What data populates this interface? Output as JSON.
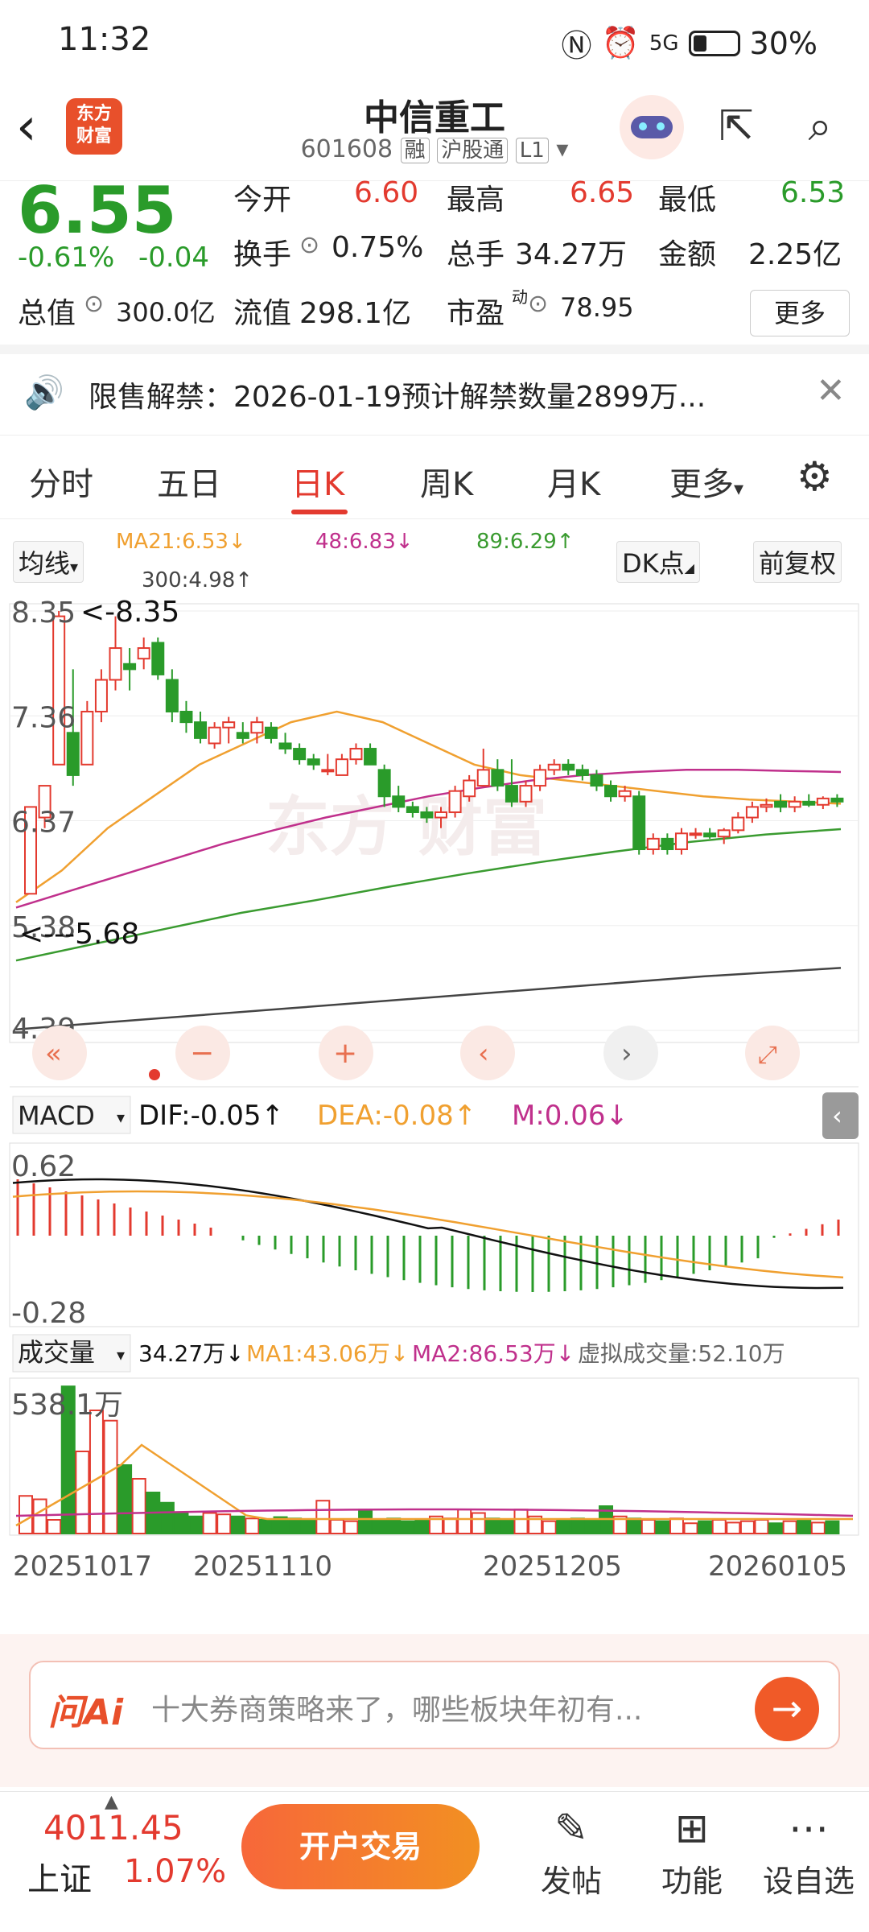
{
  "status": {
    "time": "11:32",
    "signal": "5G",
    "battery": "30%"
  },
  "header": {
    "logo_line1": "东方",
    "logo_line2": "财富",
    "name": "中信重工",
    "code": "601608",
    "tag1": "融",
    "tag2": "沪股通",
    "tag3": "L1"
  },
  "quote": {
    "price": "6.55",
    "change_pct": "-0.61%",
    "change": "-0.04",
    "open_label": "今开",
    "open": "6.60",
    "high_label": "最高",
    "high": "6.65",
    "low_label": "最低",
    "low": "6.53",
    "turnover_label": "换手",
    "turnover": "0.75%",
    "volume_label": "总手",
    "volume": "34.27万",
    "amount_label": "金额",
    "amount": "2.25亿",
    "mktcap_label": "总值",
    "mktcap": "300.0亿",
    "float_label": "流值",
    "float": "298.1亿",
    "pe_label": "市盈",
    "pe_sup": "动",
    "pe": "78.95",
    "more": "更多"
  },
  "notice": {
    "text": "限售解禁：2026-01-19预计解禁数量2899万..."
  },
  "tabs": [
    "分时",
    "五日",
    "日K",
    "周K",
    "月K",
    "更多"
  ],
  "active_tab": "日K",
  "ma_bar": {
    "selector": "均线",
    "ma21": "MA21:6.53↓",
    "ma48": "48:6.83↓",
    "ma89": "89:6.29↑",
    "ma300": "300:4.98↑",
    "dk": "DK点",
    "fq": "前复权"
  },
  "colors": {
    "up": "#e33a2f",
    "down": "#2a9b2a",
    "ma21": "#f0a030",
    "ma48": "#c0308c",
    "ma89": "#3a9b30",
    "ma300": "#444444",
    "accent": "#e8502b"
  },
  "chart_data": [
    {
      "type": "candlestick",
      "title": "日K",
      "y_ticks": [
        "8.35",
        "7.36",
        "6.37",
        "5.38",
        "4.39"
      ],
      "annotations": [
        "<-8.35",
        "<---5.68"
      ],
      "ylim": [
        4.39,
        8.35
      ],
      "series": [
        {
          "name": "MA21",
          "values": [
            5.6,
            5.9,
            6.3,
            6.6,
            6.9,
            7.1,
            7.3,
            7.4,
            7.3,
            7.1,
            6.9,
            6.8,
            6.75,
            6.7,
            6.65,
            6.6,
            6.57,
            6.55,
            6.53
          ]
        },
        {
          "name": "48",
          "values": [
            5.55,
            5.7,
            5.85,
            6.0,
            6.15,
            6.28,
            6.4,
            6.5,
            6.6,
            6.68,
            6.75,
            6.8,
            6.83,
            6.85,
            6.85,
            6.84,
            6.83
          ]
        },
        {
          "name": "89",
          "values": [
            5.05,
            5.2,
            5.35,
            5.5,
            5.62,
            5.75,
            5.87,
            5.98,
            6.08,
            6.17,
            6.24,
            6.29
          ]
        },
        {
          "name": "300",
          "values": [
            4.4,
            4.5,
            4.6,
            4.7,
            4.8,
            4.9,
            4.98
          ]
        }
      ],
      "candles": [
        [
          5.68,
          6.5,
          5.68,
          6.5
        ],
        [
          6.4,
          6.7,
          6.3,
          6.7
        ],
        [
          6.9,
          8.35,
          6.9,
          8.3
        ],
        [
          7.2,
          7.8,
          6.7,
          6.8
        ],
        [
          6.9,
          7.5,
          6.9,
          7.4
        ],
        [
          7.4,
          7.8,
          7.3,
          7.7
        ],
        [
          7.7,
          8.3,
          7.6,
          8.0
        ],
        [
          7.85,
          8.0,
          7.6,
          7.8
        ],
        [
          7.9,
          8.1,
          7.8,
          8.0
        ],
        [
          8.05,
          8.1,
          7.7,
          7.75
        ],
        [
          7.7,
          7.8,
          7.3,
          7.4
        ],
        [
          7.4,
          7.5,
          7.2,
          7.3
        ],
        [
          7.3,
          7.4,
          7.1,
          7.15
        ],
        [
          7.1,
          7.3,
          7.05,
          7.25
        ],
        [
          7.25,
          7.35,
          7.1,
          7.3
        ],
        [
          7.2,
          7.3,
          7.1,
          7.15
        ],
        [
          7.2,
          7.35,
          7.1,
          7.3
        ],
        [
          7.25,
          7.3,
          7.1,
          7.15
        ],
        [
          7.1,
          7.2,
          7.0,
          7.05
        ],
        [
          7.05,
          7.1,
          6.9,
          6.95
        ],
        [
          6.95,
          7.0,
          6.85,
          6.9
        ],
        [
          6.85,
          7.0,
          6.8,
          6.85
        ],
        [
          6.8,
          7.0,
          6.8,
          6.95
        ],
        [
          6.95,
          7.1,
          6.9,
          7.05
        ],
        [
          7.05,
          7.1,
          6.9,
          6.9
        ],
        [
          6.85,
          6.9,
          6.5,
          6.6
        ],
        [
          6.6,
          6.7,
          6.45,
          6.5
        ],
        [
          6.5,
          6.55,
          6.4,
          6.45
        ],
        [
          6.45,
          6.5,
          6.35,
          6.4
        ],
        [
          6.4,
          6.5,
          6.3,
          6.45
        ],
        [
          6.45,
          6.7,
          6.4,
          6.65
        ],
        [
          6.6,
          6.8,
          6.55,
          6.75
        ],
        [
          6.7,
          7.05,
          6.7,
          6.85
        ],
        [
          6.85,
          6.95,
          6.65,
          6.7
        ],
        [
          6.7,
          6.95,
          6.5,
          6.55
        ],
        [
          6.55,
          6.75,
          6.5,
          6.7
        ],
        [
          6.7,
          6.9,
          6.65,
          6.85
        ],
        [
          6.85,
          6.95,
          6.8,
          6.9
        ],
        [
          6.9,
          6.95,
          6.8,
          6.85
        ],
        [
          6.85,
          6.9,
          6.75,
          6.8
        ],
        [
          6.8,
          6.85,
          6.65,
          6.7
        ],
        [
          6.7,
          6.75,
          6.55,
          6.6
        ],
        [
          6.6,
          6.7,
          6.55,
          6.65
        ],
        [
          6.6,
          6.65,
          6.05,
          6.1
        ],
        [
          6.1,
          6.25,
          6.05,
          6.2
        ],
        [
          6.2,
          6.25,
          6.05,
          6.1
        ],
        [
          6.1,
          6.3,
          6.05,
          6.25
        ],
        [
          6.25,
          6.3,
          6.2,
          6.25
        ],
        [
          6.25,
          6.3,
          6.2,
          6.22
        ],
        [
          6.22,
          6.3,
          6.15,
          6.28
        ],
        [
          6.28,
          6.45,
          6.25,
          6.4
        ],
        [
          6.4,
          6.55,
          6.35,
          6.5
        ],
        [
          6.5,
          6.58,
          6.45,
          6.52
        ],
        [
          6.55,
          6.62,
          6.45,
          6.5
        ],
        [
          6.5,
          6.6,
          6.45,
          6.55
        ],
        [
          6.55,
          6.62,
          6.5,
          6.52
        ],
        [
          6.52,
          6.6,
          6.48,
          6.58
        ],
        [
          6.58,
          6.62,
          6.5,
          6.55
        ]
      ]
    },
    {
      "type": "macd",
      "selector": "MACD",
      "dif": "DIF:-0.05↑",
      "dea": "DEA:-0.08↑",
      "m": "M:0.06↓",
      "y_ticks": [
        "0.62",
        "-0.28"
      ]
    },
    {
      "type": "bar",
      "selector": "成交量",
      "vol": "34.27万↓",
      "ma1": "MA1:43.06万↓",
      "ma2": "MA2:86.53万↓",
      "virtual": "虚拟成交量:52.10万",
      "max_label": "538.1万",
      "categories": [
        "20251017",
        "20251110",
        "20251205",
        "20260105"
      ]
    }
  ],
  "ai_bar": {
    "brand": "问Ai",
    "placeholder": "十大券商策略来了，哪些板块年初有..."
  },
  "bottom": {
    "index_value": "4011.45",
    "index_name": "上证",
    "index_pct": "1.07%",
    "trade": "开户交易",
    "post": "发帖",
    "func": "功能",
    "watch": "设自选"
  }
}
